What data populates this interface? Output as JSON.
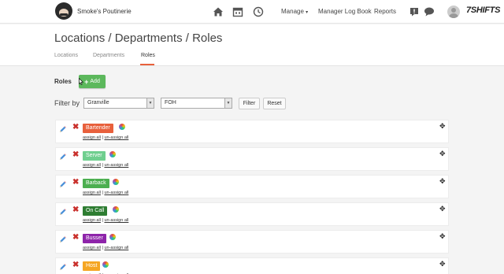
{
  "nav": {
    "brand_name": "Smoke's Poutinerie",
    "links": {
      "manage": "Manage",
      "manage_caret": "▾",
      "log_book": "Manager Log Book",
      "reports": "Reports"
    },
    "logo_text": "7SHIFTS",
    "icons": [
      "home-icon",
      "calendar-icon",
      "clock-icon",
      "alert-icon",
      "chat-icon"
    ]
  },
  "header": {
    "title": "Locations / Departments / Roles",
    "tabs": [
      {
        "label": "Locations",
        "active": false
      },
      {
        "label": "Departments",
        "active": false
      },
      {
        "label": "Roles",
        "active": true
      }
    ]
  },
  "roles": {
    "label": "Roles",
    "add_plus": "+",
    "add_label": "Add"
  },
  "filter": {
    "label": "Filter by",
    "location": "Granville",
    "department": "FOH",
    "filter_button": "Filter",
    "reset_button": "Reset"
  },
  "role_list": [
    {
      "name": "Bartender",
      "color": "#e8603c"
    },
    {
      "name": "Server",
      "color": "#6fcf8f"
    },
    {
      "name": "Barback",
      "color": "#4caf50"
    },
    {
      "name": "On Call",
      "color": "#2e7d32"
    },
    {
      "name": "Busser",
      "color": "#8e24aa"
    },
    {
      "name": "Host",
      "color": "#f5a623"
    }
  ],
  "row_actions": {
    "assign_all": "assign all",
    "separator": "|",
    "unassign_all": "un-assign all",
    "move_glyph": "✥",
    "delete_glyph": "✖"
  }
}
